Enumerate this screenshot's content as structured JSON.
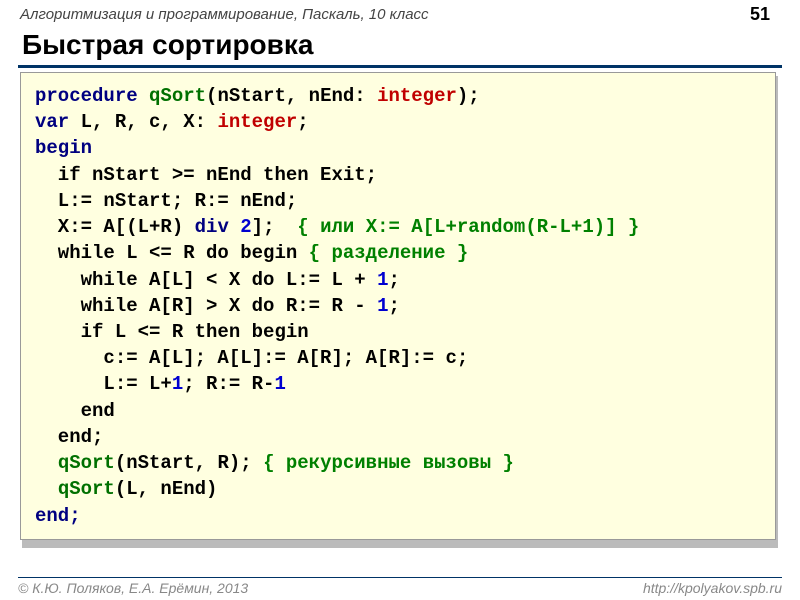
{
  "header": {
    "subject": "Алгоритмизация и программирование, Паскаль, 10 класс",
    "page": "51"
  },
  "title": "Быстрая сортировка",
  "code": {
    "kw_procedure": "procedure",
    "qsort": "qSort",
    "sig_open": "(nStart, nEnd: ",
    "integer": "integer",
    "sig_close": ");",
    "kw_var": "var",
    "var_decl": " L, R, c, X: ",
    "semicolon": ";",
    "kw_begin": "begin",
    "l3": "  if nStart >= nEnd then Exit;",
    "l4": "  L:= nStart; R:= nEnd;",
    "l5a": "  X:= A[(L+R)",
    "kw_div": "div",
    "num2": "2",
    "l5b": "];  ",
    "comment1": "{ или X:= A[L+random(R-L+1)] }",
    "l6a": "  while L <= R do begin ",
    "comment2": "{ разделение }",
    "l7a": "    while A[L] < X do L:= L + ",
    "num1a": "1",
    "l8a": "    while A[R] > X do R:= R - ",
    "num1b": "1",
    "l9": "    if L <= R then begin",
    "l10": "      c:= A[L]; A[L]:= A[R]; A[R]:= c;",
    "l11a": "      L:= L+",
    "num1c": "1",
    "l11b": "; R:= R-",
    "num1d": "1",
    "l12": "    end",
    "l13": "  end;",
    "indent2": "  ",
    "l14b": "(nStart, R); ",
    "comment3": "{ рекурсивные вызовы }",
    "l15b": "(L, nEnd)",
    "kw_end": "end;"
  },
  "footer": {
    "authors": "К.Ю. Поляков, Е.А. Ерёмин, 2013",
    "url": "http://kpolyakov.spb.ru"
  }
}
